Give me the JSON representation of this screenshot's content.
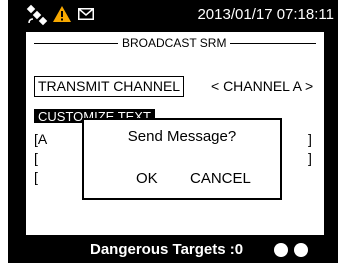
{
  "colors": {
    "screen_background": "#000000",
    "panel_background": "#ffffff",
    "warning_icon": "#f7a800",
    "text_dark": "#000000",
    "text_light": "#ffffff"
  },
  "status_bar": {
    "icons": [
      "satellite-icon",
      "warning-icon",
      "mail-icon"
    ],
    "datetime": "2013/01/17 07:18:11"
  },
  "panel": {
    "title": "BROADCAST SRM",
    "transmit_label": "TRANSMIT CHANNEL",
    "channel_value": "< CHANNEL A >",
    "customize_label": "CUSTOMIZE TEXT",
    "text_lines": [
      "[A",
      "[",
      "["
    ],
    "right_brackets": [
      "]",
      "]"
    ]
  },
  "dialog": {
    "message": "Send Message?",
    "ok_label": "OK",
    "cancel_label": "CANCEL",
    "selected": "OK"
  },
  "footer": {
    "text": "Dangerous Targets :0",
    "indicator_count": 2
  }
}
